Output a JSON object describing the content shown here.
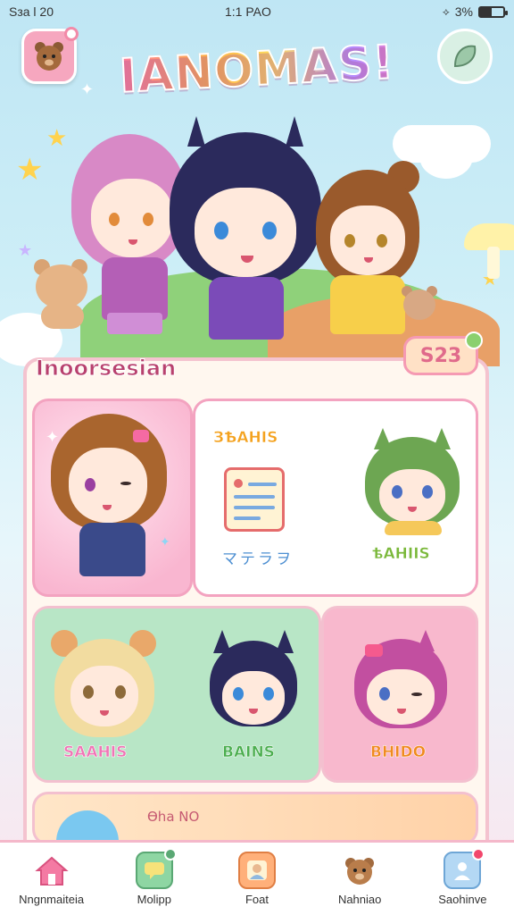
{
  "status_bar": {
    "carrier": "Ѕзa l 20",
    "time": "1:1 PAO",
    "battery": "3%",
    "battery_level": 0.5
  },
  "app": {
    "title": "IANOMAS!"
  },
  "section": {
    "title": "Inoorsesian",
    "coins": "S23"
  },
  "tiles": {
    "tile_b_top_label": "ЗѢAHIS ",
    "tile_b_caption": "マテラヲ",
    "tile_b_bottom_label": "ѣAHIIS",
    "tile_c_label_1": "SAAHIS",
    "tile_c_label_2": "BAINS",
    "tile_d_label": "BHIDO",
    "tile_e_text": "Ѳha NO"
  },
  "bottom_nav": {
    "items": [
      {
        "label": "Nngnmaiteia",
        "icon": "home-icon",
        "color": "#f47aa3"
      },
      {
        "label": "Molipp",
        "icon": "chat-icon",
        "color": "#8ed6a3"
      },
      {
        "label": "Foat",
        "icon": "character-icon",
        "color": "#ffb07a"
      },
      {
        "label": "Nahniao",
        "icon": "bear-icon",
        "color": "#f7d0b0"
      },
      {
        "label": "Saohinve",
        "icon": "profile-icon",
        "color": "#b4d8f4"
      }
    ]
  },
  "colors": {
    "accent_pink": "#f47aa3",
    "card_border": "#f4c3cf",
    "mint": "#b8e6c6"
  }
}
